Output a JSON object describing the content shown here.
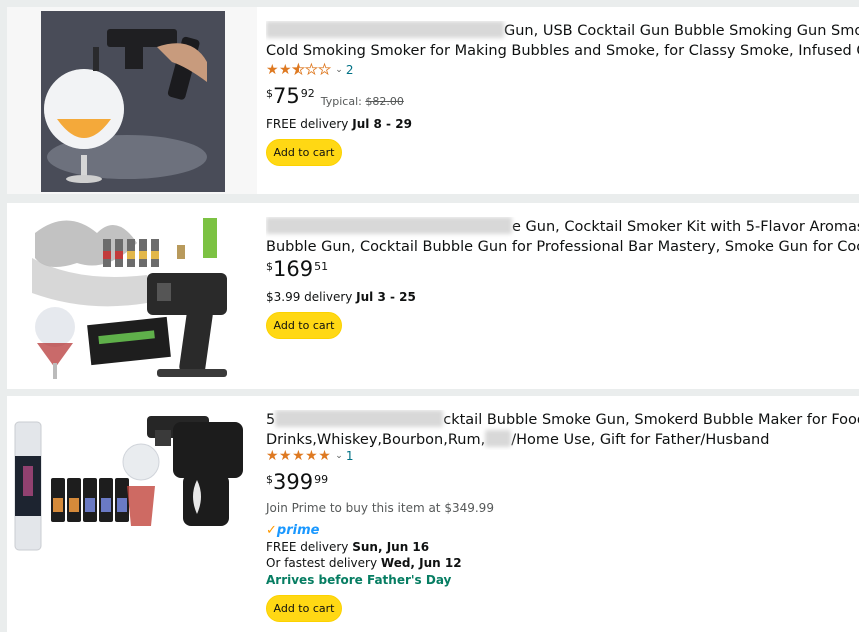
{
  "results": [
    {
      "title_line1": "Gun, USB Cocktail Gun Bubble Smoking Gun Smoker",
      "title_line2": "Cold Smoking Smoker for Making Bubbles and Smoke, for Classy Smoke, Infused Cock",
      "rating_stars": 2.5,
      "review_count": "2",
      "price_symbol": "$",
      "price_whole": "75",
      "price_fraction": "92",
      "typical_label": "Typical:",
      "typical_price": "$82.00",
      "delivery_prefix": "FREE delivery ",
      "delivery_date": "Jul 8 - 29",
      "add_to_cart": "Add to cart",
      "image_icon": "cocktail-bubble-smoker-gun-image"
    },
    {
      "title_line1": "e Gun, Cocktail Smoker Kit with 5-Flavor Aromas",
      "title_line2": "Bubble Gun, Cocktail Bubble Gun for Professional Bar Mastery, Smoke Gun for Cockta",
      "price_symbol": "$",
      "price_whole": "169",
      "price_fraction": "51",
      "delivery_prefix": "$3.99 delivery ",
      "delivery_date": "Jul 3 - 25",
      "add_to_cart": "Add to cart",
      "image_icon": "smoker-kit-with-flavor-bottles-image"
    },
    {
      "title_line1_start": "5",
      "title_line1": "cktail Bubble Smoke Gun, Smokerd Bubble Maker for Food",
      "title_line2_a": "Drinks,Whiskey,Bourbon,Rum,",
      "title_line2_b": "/Home Use, Gift for Father/Husband",
      "rating_stars": 5,
      "review_count": "1",
      "price_symbol": "$",
      "price_whole": "399",
      "price_fraction": "99",
      "prime_offer": "Join Prime to buy this item at $349.99",
      "prime_label": "prime",
      "delivery_prefix": "FREE delivery ",
      "delivery_date": "Sun, Jun 16",
      "fastest_prefix": "Or fastest delivery ",
      "fastest_date": "Wed, Jun 12",
      "arrives_note": "Arrives before Father's Day",
      "add_to_cart": "Add to cart",
      "image_icon": "bubble-smoke-gun-kit-image"
    }
  ],
  "colors": {
    "button": "#ffd814",
    "link": "#007185",
    "star": "#de7921",
    "green": "#067d62",
    "prime": "#1a98ff"
  }
}
